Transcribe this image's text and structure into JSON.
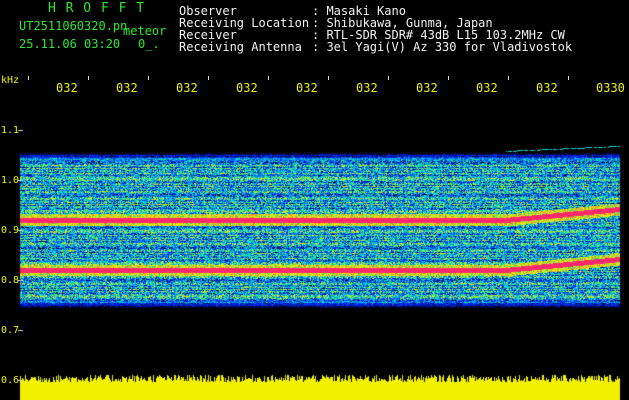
{
  "header": {
    "brand": "H R O F F T",
    "filename": "UT2511060320.pn",
    "mode": "meteor",
    "datetime": "25.11.06 03:20",
    "counter": "0_.",
    "info_labels": [
      "Observer",
      "Receiving Location",
      "Receiver",
      "Receiving Antenna"
    ],
    "info_values": [
      ": Masaki Kano",
      ": Shibukawa, Gunma, Japan",
      ": RTL-SDR SDR# 43dB L15 103.2MHz CW",
      ": 3el Yagi(V) Az 330 for Vladivostok"
    ]
  },
  "y_axis": {
    "unit": "kHz",
    "ticks": [
      "1.1",
      "1.0",
      "0.9",
      "0.8",
      "0.7",
      "0.6"
    ]
  },
  "time_axis": {
    "labels": [
      "032",
      "032",
      "032",
      "032",
      "032",
      "032",
      "032",
      "032",
      "032",
      "0330"
    ]
  },
  "colors": {
    "background": "#000000",
    "header_green": "#2ee82e",
    "header_white": "#f2f2f2",
    "axis_yellow": "#f2f200",
    "band_noise": "#0018c8",
    "band_signal": "#ff2a6e",
    "power_bar": "#f2f200"
  },
  "spectrogram": {
    "freq_range_khz": [
      0.6,
      1.15
    ],
    "band_khz": [
      0.75,
      1.05
    ],
    "signal_traces_khz": [
      0.92,
      0.82
    ],
    "late_drift_khz": 0.01
  }
}
